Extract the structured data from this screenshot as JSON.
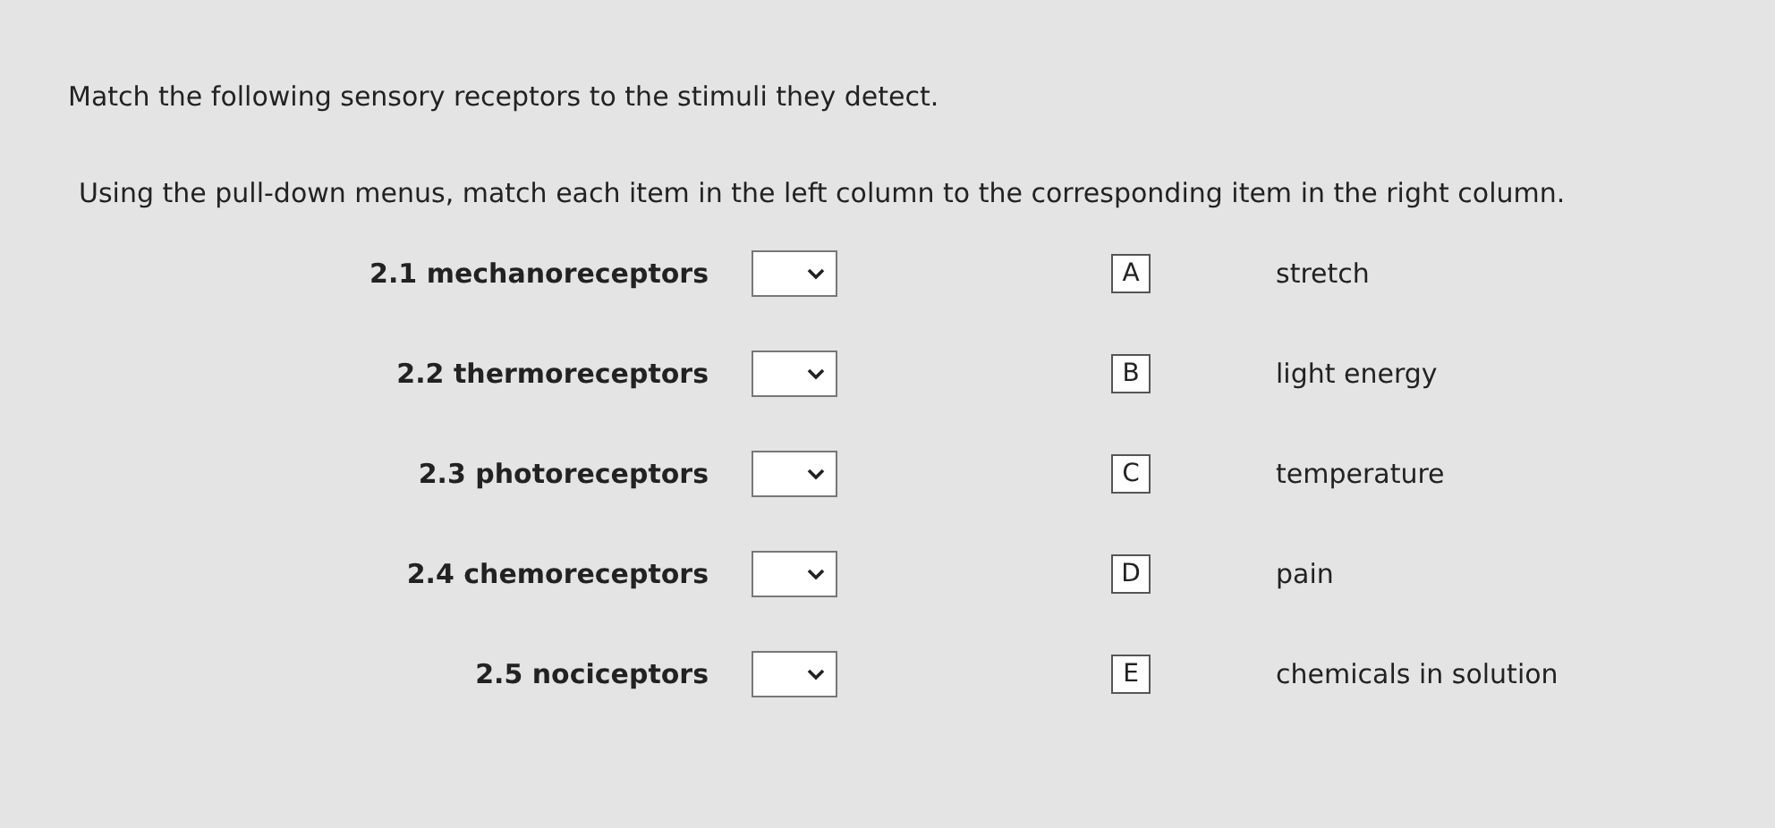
{
  "title": "Match the following sensory receptors to the stimuli they detect.",
  "instructions": "Using the pull-down menus, match each item in the left column to the corresponding item in the right column.",
  "left_items": [
    {
      "label": "2.1 mechanoreceptors"
    },
    {
      "label": "2.2 thermoreceptors"
    },
    {
      "label": "2.3 photoreceptors"
    },
    {
      "label": "2.4 chemoreceptors"
    },
    {
      "label": "2.5 nociceptors"
    }
  ],
  "right_items": [
    {
      "letter": "A",
      "text": "stretch"
    },
    {
      "letter": "B",
      "text": "light energy"
    },
    {
      "letter": "C",
      "text": "temperature"
    },
    {
      "letter": "D",
      "text": "pain"
    },
    {
      "letter": "E",
      "text": "chemicals in solution"
    }
  ]
}
